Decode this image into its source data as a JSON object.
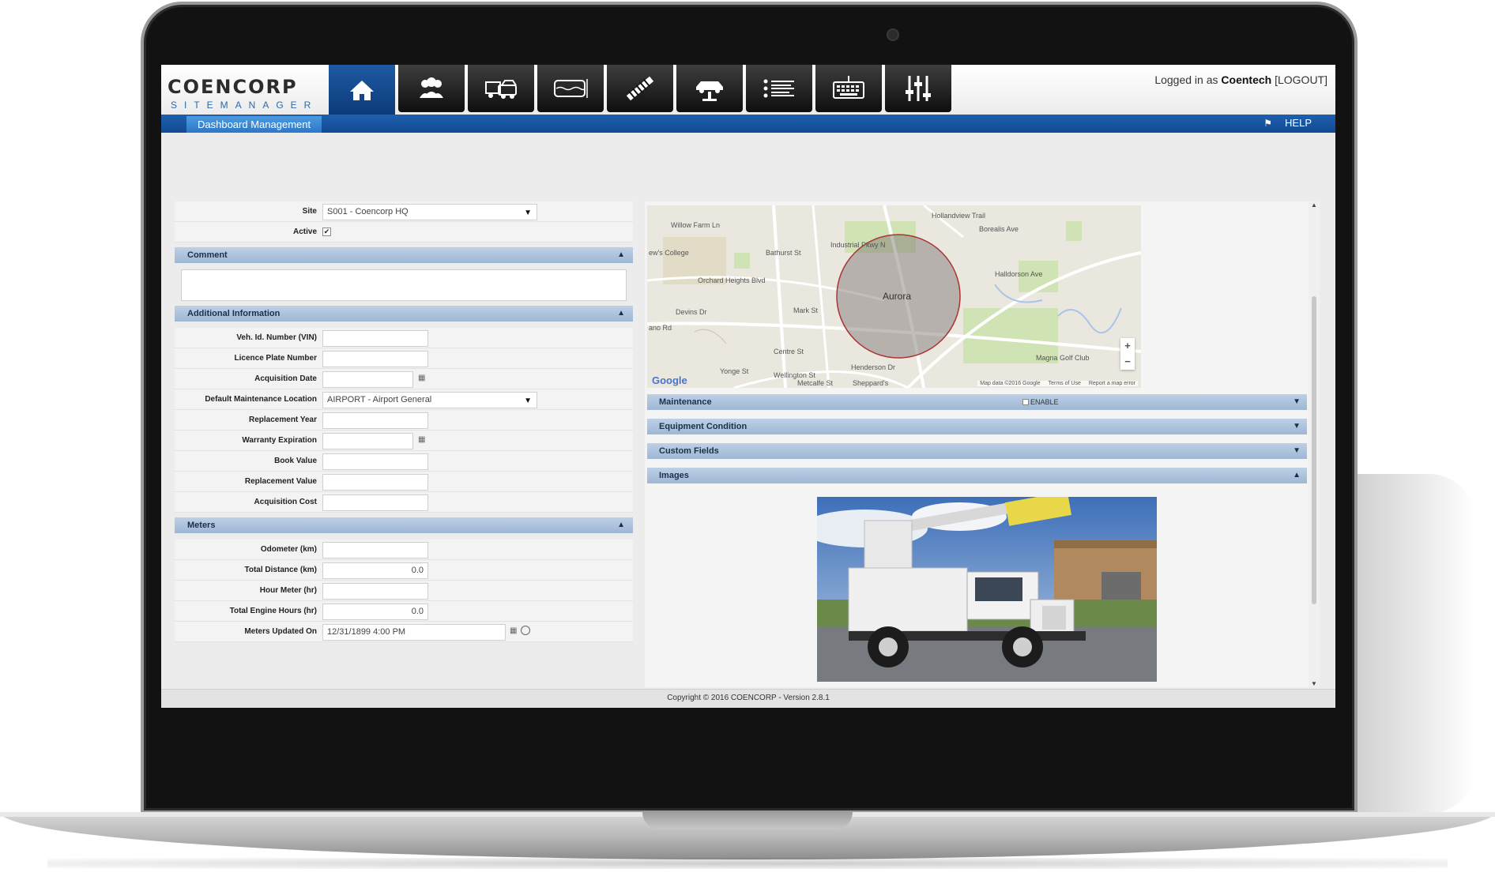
{
  "header": {
    "logo_main": "COENCORP",
    "logo_sub": "SITEMANAGER",
    "nav": [
      {
        "icon": "home-icon",
        "active": true
      },
      {
        "icon": "users-icon"
      },
      {
        "icon": "trucks-icon"
      },
      {
        "icon": "fuel-tank-icon"
      },
      {
        "icon": "hose-icon"
      },
      {
        "icon": "vehicle-lift-icon"
      },
      {
        "icon": "list-icon"
      },
      {
        "icon": "keypad-icon"
      },
      {
        "icon": "settings-sliders-icon"
      }
    ],
    "login_prefix": "Logged in as",
    "login_user": "Coentech",
    "logout_label": "[LOGOUT]"
  },
  "subbar": {
    "tab_label": "Dashboard Management",
    "help_label": "HELP"
  },
  "form": {
    "site_label": "Site",
    "site_value": "S001 - Coencorp HQ",
    "active_label": "Active",
    "active_checked": "✔",
    "comment_section": "Comment",
    "comment_value": "",
    "additional_section": "Additional Information",
    "vin_label": "Veh. Id. Number (VIN)",
    "vin_value": "",
    "plate_label": "Licence Plate Number",
    "plate_value": "",
    "acq_date_label": "Acquisition Date",
    "acq_date_value": "",
    "maint_loc_label": "Default Maintenance Location",
    "maint_loc_value": "AIRPORT - Airport General",
    "repl_year_label": "Replacement Year",
    "repl_year_value": "",
    "warranty_label": "Warranty Expiration",
    "warranty_value": "",
    "book_label": "Book Value",
    "book_value": "",
    "repl_value_label": "Replacement Value",
    "repl_value_value": "",
    "acq_cost_label": "Acquisition Cost",
    "acq_cost_value": "",
    "meters_section": "Meters",
    "odometer_label": "Odometer (km)",
    "odometer_value": "",
    "total_dist_label": "Total Distance (km)",
    "total_dist_value": "0.0",
    "hour_meter_label": "Hour Meter (hr)",
    "hour_meter_value": "",
    "engine_hours_label": "Total Engine Hours (hr)",
    "engine_hours_value": "0.0",
    "meters_updated_label": "Meters Updated On",
    "meters_updated_value": "12/31/1899 4:00 PM"
  },
  "map": {
    "center_label": "Aurora",
    "labels": [
      "Willow Farm Ln",
      "ew's College",
      "Orchard Heights Blvd",
      "Devins Dr",
      "ano Rd",
      "Bathurst St",
      "Industrial Pkwy N",
      "Hollandview Trail",
      "Borealis Ave",
      "Henderson Dr",
      "Halldorson Ave",
      "Mark St",
      "Centre St",
      "Wellington St",
      "Magna Golf Club",
      "Yonge St",
      "Metcalfe St",
      "Sheppard's"
    ],
    "google": "Google",
    "footer": [
      "Map data ©2016 Google",
      "Terms of Use",
      "Report a map error"
    ],
    "zoom_in": "+",
    "zoom_out": "−"
  },
  "right_sections": {
    "maintenance": "Maintenance",
    "enable_label": "ENABLE",
    "equipment": "Equipment Condition",
    "custom": "Custom Fields",
    "images": "Images"
  },
  "footer": {
    "copyright": "Copyright © 2016 COENCORP - Version 2.8.1"
  },
  "colors": {
    "brand_blue": "#1d5fb0",
    "section_header": "#afc4dd",
    "nav_dark": "#1a1a1a"
  }
}
